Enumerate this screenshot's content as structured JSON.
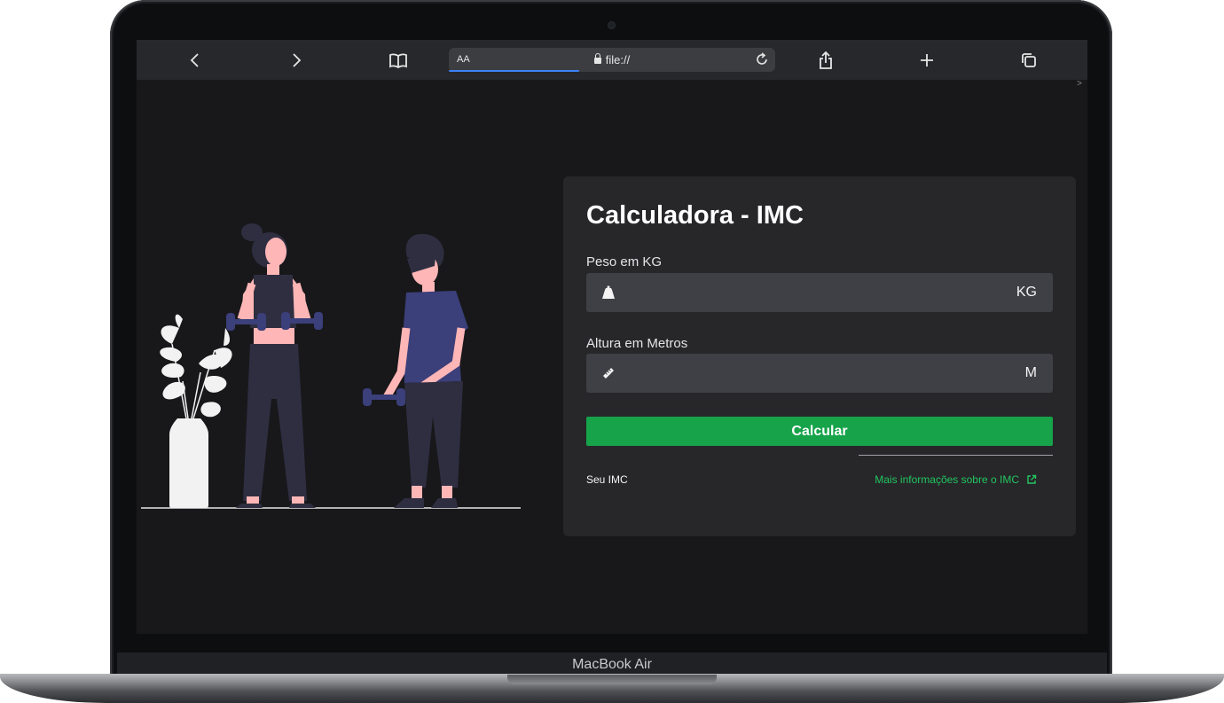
{
  "device": {
    "label": "MacBook Air"
  },
  "browser": {
    "aa_label": "AA",
    "address": "file://",
    "load_progress": 0.4,
    "icons": [
      "chevron-left-icon",
      "chevron-right-icon",
      "book-icon",
      "reload-icon",
      "share-icon",
      "plus-icon",
      "tabs-icon"
    ],
    "corner_glyph": ">"
  },
  "page": {
    "title": "Calculadora - IMC",
    "weight": {
      "label": "Peso em KG",
      "unit": "KG",
      "value": "",
      "icon": "weight-icon"
    },
    "height": {
      "label": "Altura em Metros",
      "unit": "M",
      "value": "",
      "icon": "ruler-icon"
    },
    "calc_button": "Calcular",
    "result_label": "Seu IMC",
    "info_link": "Mais informações sobre o IMC"
  },
  "colors": {
    "accent": "#16a34a",
    "link": "#22c55e",
    "card": "#27272a",
    "background": "#18181b"
  }
}
